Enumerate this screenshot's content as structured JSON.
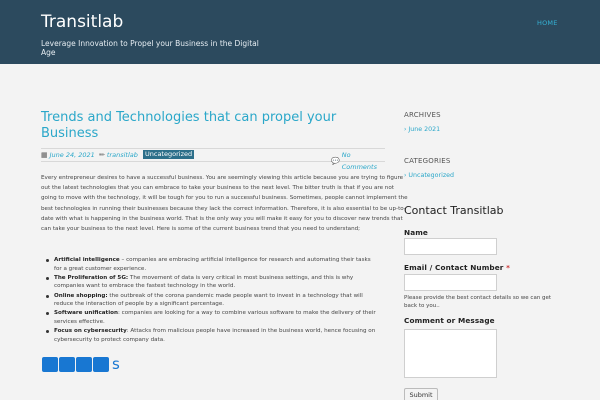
{
  "header": {
    "site_title": "Transitlab",
    "tagline": "Leverage Innovation to Propel your Business in the Digital Age",
    "nav_home": "HOME"
  },
  "post": {
    "title": "Trends and Technologies that can propel your Business",
    "date": "June 24, 2021",
    "author": "transitlab",
    "category": "Uncategorized",
    "comments": "No Comments",
    "body": "Every entrepreneur desires to have a successful business. You are seemingly viewing this article because you are trying to figure out the latest technologies that you can embrace to take your business to the next level. The bitter truth is that if you are not going to move with the technology, it will be tough for you to run a successful business. Sometimes, people cannot implement the best technologies in running their businesses because they lack the correct information. Therefore, it is also essential to be up-to-date with what is happening in the business world. That is the only way you will make it easy for you to discover new trends that can take your business to the next level. Here is some of the current business trend that you need to understand;",
    "list": [
      {
        "term": "Artificial intelligence",
        "text": " – companies are embracing artificial intelligence for research and automating their tasks for a great customer experience."
      },
      {
        "term": "The Proliferation of 5G:",
        "text": " The movement of data is very critical in most business settings, and this is why companies want to embrace the fastest technology in the world."
      },
      {
        "term": "Online shopping:",
        "text": " the outbreak of the corona pandemic made people want to invest in a technology that will reduce the interaction of people by a significant percentage."
      },
      {
        "term": "Software unification",
        "text": ": companies are looking for a way to combine various software to make the delivery of their services effective."
      },
      {
        "term": "Focus on cybersecurity",
        "text": ": Attacks from malicious people have increased in the business world, hence focusing on cybersecurity to protect company data."
      }
    ],
    "share_trailing": "s"
  },
  "sidebar": {
    "archives_title": "ARCHIVES",
    "archives_link": "June 2021",
    "categories_title": "CATEGORIES",
    "categories_link": "Uncategorized"
  },
  "contact": {
    "title": "Contact Transitlab",
    "name_label": "Name",
    "email_label": "Email / Contact Number",
    "required_mark": "*",
    "hint": "Please provide the best contact details so we can get back to you..",
    "message_label": "Comment or Message",
    "submit": "Submit"
  },
  "colors": {
    "header_bg": "#2c4a5e",
    "link": "#2aa7c9",
    "share_blue": "#1877d2"
  }
}
